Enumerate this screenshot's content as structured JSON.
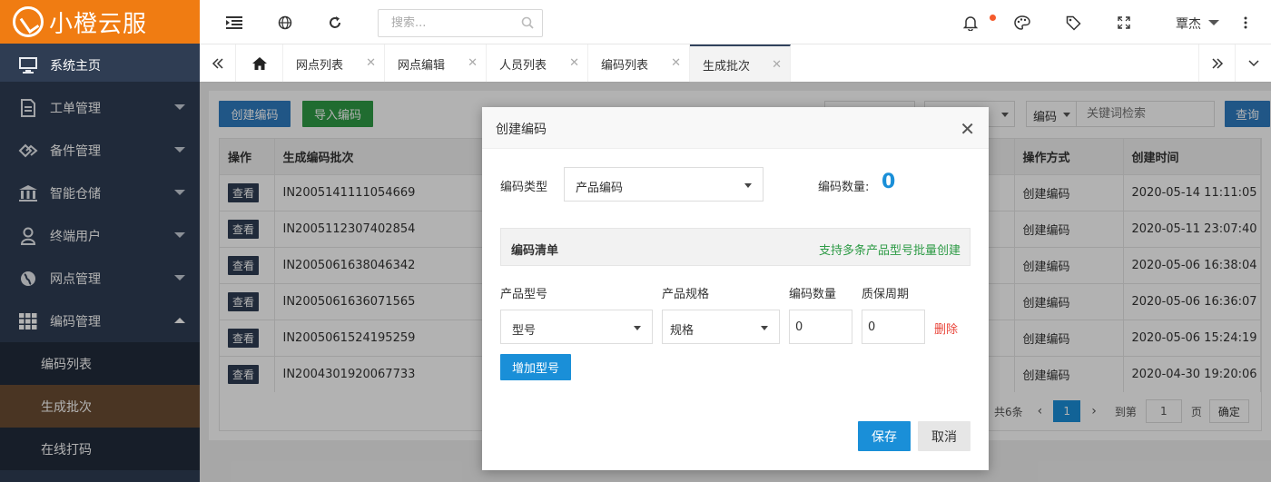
{
  "app": {
    "logo_text": "小橙云服"
  },
  "sidebar": {
    "items": [
      {
        "label": "系统主页",
        "icon": "monitor-icon"
      },
      {
        "label": "工单管理",
        "icon": "document-icon"
      },
      {
        "label": "备件管理",
        "icon": "diamond-icon"
      },
      {
        "label": "智能仓储",
        "icon": "bank-icon"
      },
      {
        "label": "终端用户",
        "icon": "user-icon"
      },
      {
        "label": "网点管理",
        "icon": "globe-icon"
      },
      {
        "label": "编码管理",
        "icon": "grid-icon"
      }
    ],
    "subitems": [
      {
        "label": "编码列表"
      },
      {
        "label": "生成批次"
      },
      {
        "label": "在线打码"
      }
    ]
  },
  "topbar": {
    "search_placeholder": "搜索...",
    "username": "覃杰"
  },
  "tabs": [
    {
      "label": "网点列表"
    },
    {
      "label": "网点编辑"
    },
    {
      "label": "人员列表"
    },
    {
      "label": "编码列表"
    },
    {
      "label": "生成批次"
    }
  ],
  "toolbar": {
    "create_label": "创建编码",
    "import_label": "导入编码",
    "filter_field": "编码",
    "keyword_placeholder": "关键词检索",
    "query_label": "查询"
  },
  "table": {
    "headers": {
      "op": "操作",
      "batch": "生成编码批次",
      "method": "操作方式",
      "time": "创建时间"
    },
    "view_label": "查看",
    "rows": [
      {
        "batch": "IN2005141111054669",
        "method": "创建编码",
        "time": "2020-05-14 11:11:05"
      },
      {
        "batch": "IN2005112307402854",
        "method": "创建编码",
        "time": "2020-05-11 23:07:40"
      },
      {
        "batch": "IN2005061638046342",
        "method": "创建编码",
        "time": "2020-05-06 16:38:04"
      },
      {
        "batch": "IN2005061636071565",
        "method": "创建编码",
        "time": "2020-05-06 16:36:07"
      },
      {
        "batch": "IN2005061524195259",
        "method": "创建编码",
        "time": "2020-05-06 15:24:19"
      },
      {
        "batch": "IN2004301920067733",
        "method": "创建编码",
        "time": "2020-04-30 19:20:06"
      }
    ]
  },
  "pager": {
    "total": "共6条",
    "current_page": "1",
    "goto_label": "到第",
    "goto_value": "1",
    "page_unit": "页",
    "confirm_label": "确定"
  },
  "modal": {
    "title": "创建编码",
    "code_type_label": "编码类型",
    "code_type_value": "产品编码",
    "code_count_label": "编码数量:",
    "code_count_value": "0",
    "list_title": "编码清单",
    "list_hint": "支持多条产品型号批量创建",
    "col_model": "产品型号",
    "col_spec": "产品规格",
    "col_qty": "编码数量",
    "col_warranty": "质保周期",
    "model_placeholder": "型号",
    "spec_placeholder": "规格",
    "qty_value": "0",
    "warranty_value": "0",
    "delete_label": "删除",
    "add_model_label": "增加型号",
    "save_label": "保存",
    "cancel_label": "取消"
  },
  "colors": {
    "accent_orange": "#f07c12",
    "sidebar_bg": "#2f3d53",
    "primary_blue": "#1a8fd8",
    "green": "#2f9b45",
    "delete_red": "#e9453a",
    "hint_green": "#2e9b46"
  }
}
